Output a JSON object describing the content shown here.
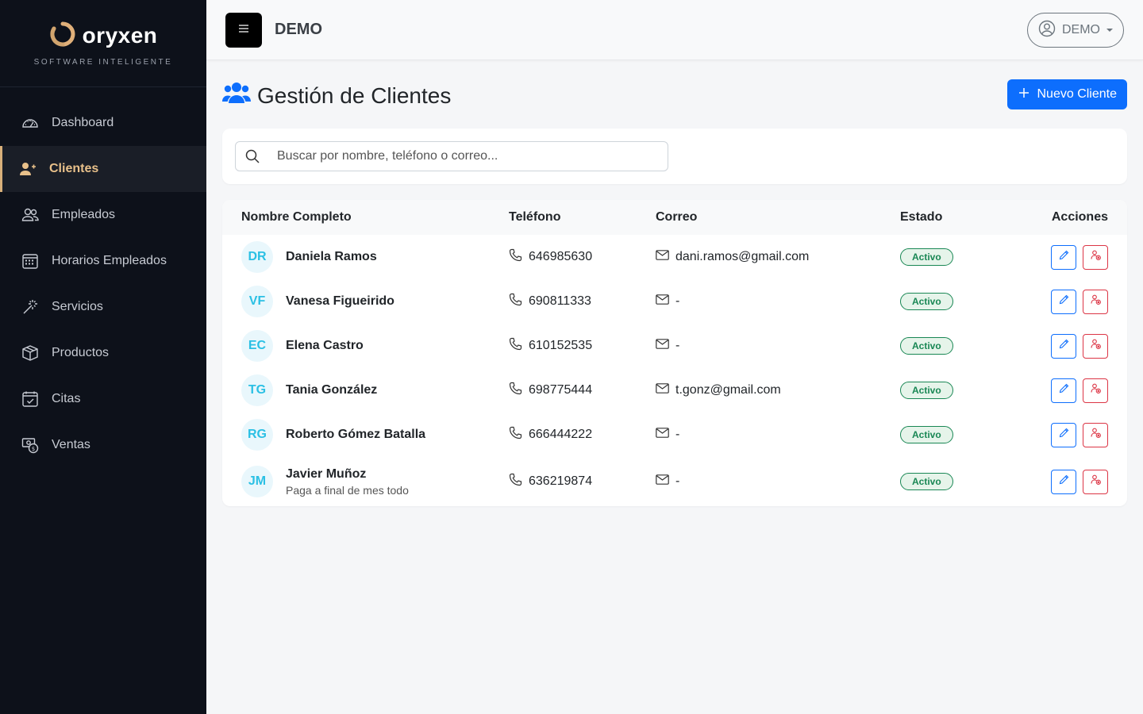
{
  "brand": {
    "name": "oryxen",
    "subtitle": "SOFTWARE INTELIGENTE"
  },
  "sidebar": {
    "items": [
      {
        "label": "Dashboard",
        "icon": "speedometer-icon",
        "active": false
      },
      {
        "label": "Clientes",
        "icon": "users-icon",
        "active": true
      },
      {
        "label": "Empleados",
        "icon": "people-icon",
        "active": false
      },
      {
        "label": "Horarios Empleados",
        "icon": "calendar-grid-icon",
        "active": false
      },
      {
        "label": "Servicios",
        "icon": "magic-wand-icon",
        "active": false
      },
      {
        "label": "Productos",
        "icon": "box-icon",
        "active": false
      },
      {
        "label": "Citas",
        "icon": "calendar-check-icon",
        "active": false
      },
      {
        "label": "Ventas",
        "icon": "cash-coin-icon",
        "active": false
      }
    ]
  },
  "topbar": {
    "title": "DEMO",
    "user": "DEMO"
  },
  "page": {
    "title": "Gestión de Clientes",
    "new_button": "Nuevo Cliente"
  },
  "search": {
    "placeholder": "Buscar por nombre, teléfono o correo..."
  },
  "table": {
    "headers": {
      "name": "Nombre Completo",
      "phone": "Teléfono",
      "email": "Correo",
      "state": "Estado",
      "actions": "Acciones"
    },
    "rows": [
      {
        "initials": "DR",
        "name": "Daniela Ramos",
        "note": "",
        "phone": "646985630",
        "email": "dani.ramos@gmail.com",
        "state": "Activo"
      },
      {
        "initials": "VF",
        "name": "Vanesa Figueirido",
        "note": "",
        "phone": "690811333",
        "email": "-",
        "state": "Activo"
      },
      {
        "initials": "EC",
        "name": "Elena Castro",
        "note": "",
        "phone": "610152535",
        "email": "-",
        "state": "Activo"
      },
      {
        "initials": "TG",
        "name": "Tania González",
        "note": "",
        "phone": "698775444",
        "email": "t.gonz@gmail.com",
        "state": "Activo"
      },
      {
        "initials": "RG",
        "name": "Roberto Gómez Batalla",
        "note": "",
        "phone": "666444222",
        "email": "-",
        "state": "Activo"
      },
      {
        "initials": "JM",
        "name": "Javier Muñoz",
        "note": "Paga a final de mes todo",
        "phone": "636219874",
        "email": "-",
        "state": "Activo"
      }
    ]
  },
  "colors": {
    "sidebar_bg": "#0d111a",
    "accent_gold": "#d8b07a",
    "primary": "#0d6efd",
    "danger": "#dc3545",
    "success": "#198754",
    "avatar_text": "#2bc0e4"
  }
}
